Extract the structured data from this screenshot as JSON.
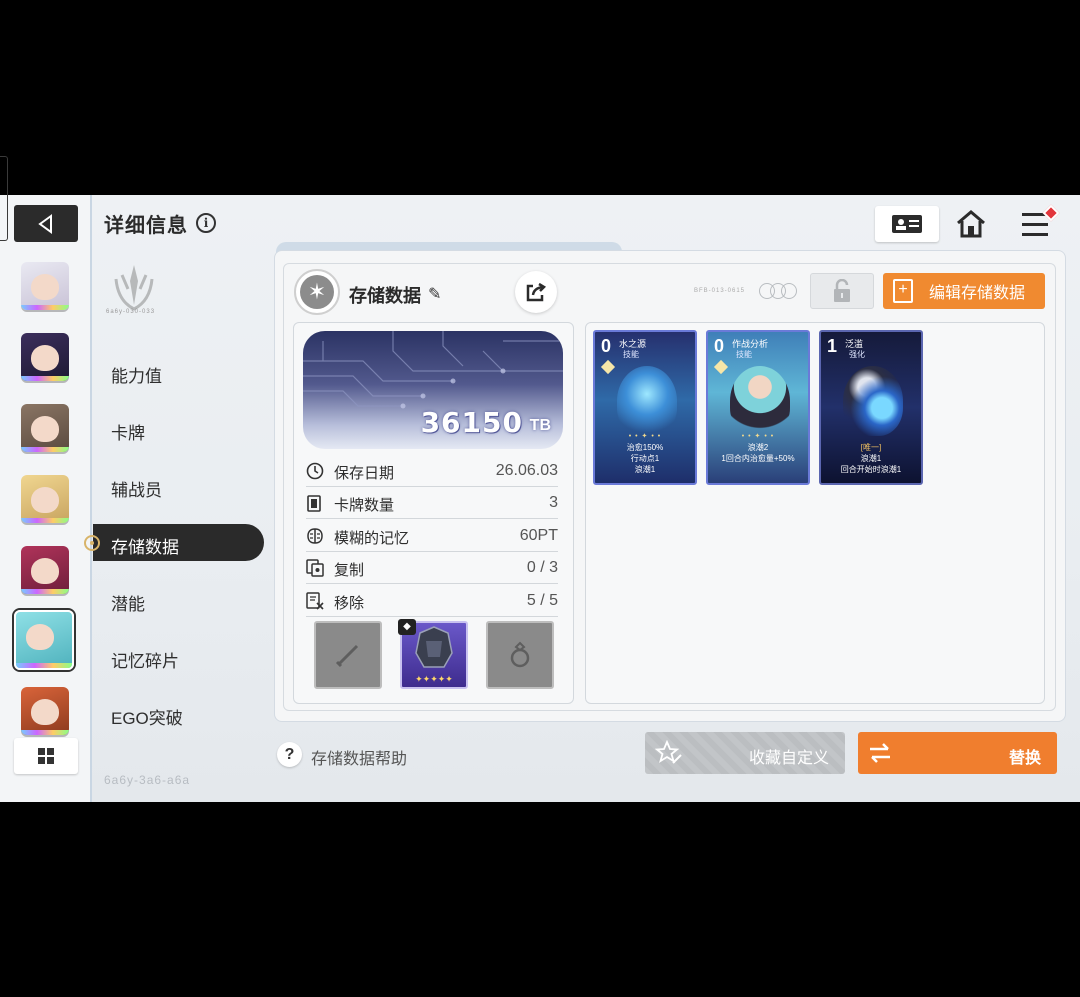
{
  "header": {
    "title": "详细信息"
  },
  "menu": {
    "items": [
      "能力值",
      "卡牌",
      "辅战员",
      "存储数据",
      "潜能",
      "记忆碎片",
      "EGO突破"
    ],
    "active": "存储数据"
  },
  "emblem_text": "6a6y-030-033",
  "footer_text": "6a6y-3a6-a6a",
  "save": {
    "title": "存储数据",
    "tiny_code": "BFB-013-0615",
    "edit_label": "编辑存储数据",
    "capacity_value": "36150",
    "capacity_unit": "TB",
    "stats": [
      {
        "label": "保存日期",
        "value": "26.06.03",
        "icon": "clock-icon"
      },
      {
        "label": "卡牌数量",
        "value": "3",
        "icon": "card-count-icon"
      },
      {
        "label": "模糊的记忆",
        "value": "60PT",
        "icon": "brain-icon"
      },
      {
        "label": "复制",
        "value": "0 / 3",
        "icon": "copy-icon"
      },
      {
        "label": "移除",
        "value": "5 / 5",
        "icon": "remove-icon"
      }
    ],
    "equipment": [
      {
        "slot": "weapon",
        "state": "empty",
        "icon": "sword-icon"
      },
      {
        "slot": "armor",
        "state": "equipped",
        "icon": "armor-icon",
        "stars": "✦✦✦✦✦"
      },
      {
        "slot": "ring",
        "state": "empty",
        "icon": "ring-icon"
      }
    ]
  },
  "cards": [
    {
      "cost": "0",
      "name": "水之源",
      "type": "技能",
      "desc": [
        "治愈150%",
        "行动点1",
        "浪潮1"
      ],
      "stars": "• • ✦ • •"
    },
    {
      "cost": "0",
      "name": "作战分析",
      "type": "技能",
      "desc": [
        "浪潮2",
        "1回合内治愈量+50%"
      ],
      "stars": "• • ✦ • •"
    },
    {
      "cost": "1",
      "name": "泛滥",
      "type": "强化",
      "desc": [
        "[唯一]",
        "浪潮1",
        "回合开始时浪潮1"
      ],
      "stars": ""
    }
  ],
  "bottom": {
    "help_label": "存储数据帮助",
    "favorite_label": "收藏自定义",
    "replace_label": "替换"
  },
  "colors": {
    "accent": "#f08a30",
    "dark": "#2a2a2a",
    "card_border": "#6a7ad8"
  }
}
